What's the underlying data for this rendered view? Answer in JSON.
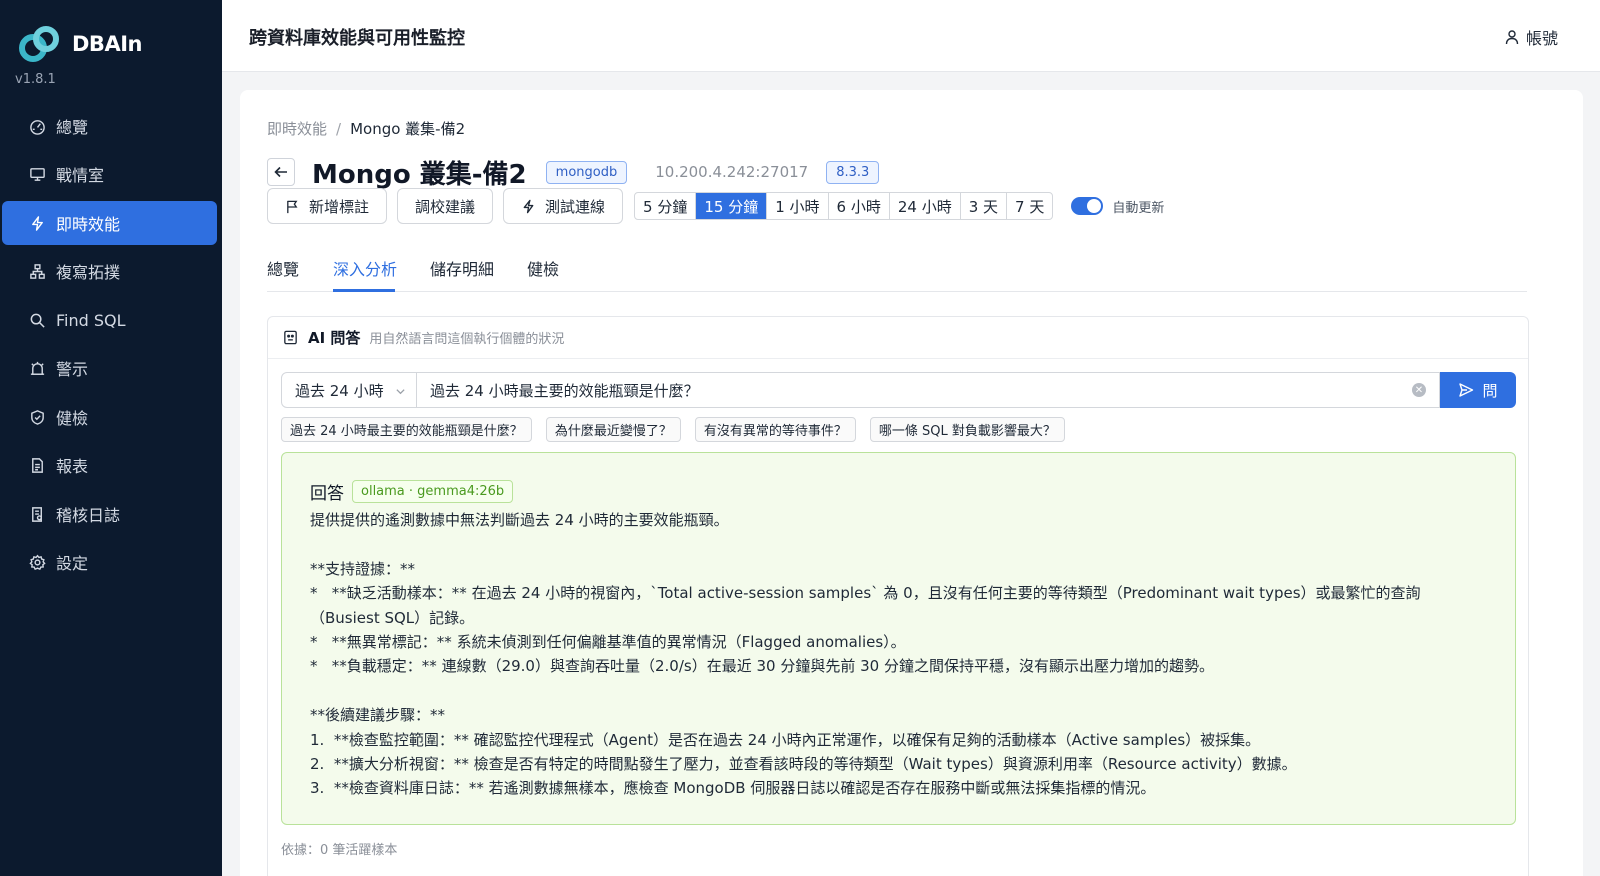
{
  "app": {
    "name": "DBAIn",
    "version": "v1.8.1",
    "header_title": "跨資料庫效能與可用性監控",
    "account_label": "帳號"
  },
  "sidebar": {
    "items": [
      {
        "label": "總覽",
        "icon": "dashboard-icon"
      },
      {
        "label": "戰情室",
        "icon": "monitor-icon"
      },
      {
        "label": "即時效能",
        "icon": "lightning-icon",
        "active": true
      },
      {
        "label": "複寫拓撲",
        "icon": "topology-icon"
      },
      {
        "label": "Find SQL",
        "icon": "search-icon"
      },
      {
        "label": "警示",
        "icon": "alarm-icon"
      },
      {
        "label": "健檢",
        "icon": "shield-icon"
      },
      {
        "label": "報表",
        "icon": "document-icon"
      },
      {
        "label": "稽核日誌",
        "icon": "audit-icon"
      },
      {
        "label": "設定",
        "icon": "gear-icon"
      }
    ]
  },
  "breadcrumb": {
    "parent": "即時效能",
    "separator": "/",
    "current": "Mongo 叢集-備2"
  },
  "instance": {
    "title": "Mongo 叢集-備2",
    "engine_tag": "mongodb",
    "host": "10.200.4.242:27017",
    "version_tag": "8.3.3"
  },
  "actions": {
    "add_annotation": "新增標註",
    "tuning_advice": "調校建議",
    "test_connection": "測試連線"
  },
  "time_ranges": {
    "options": [
      "5 分鐘",
      "15 分鐘",
      "1 小時",
      "6 小時",
      "24 小時",
      "3 天",
      "7 天"
    ],
    "selected": "15 分鐘"
  },
  "auto_refresh": {
    "label": "自動更新",
    "enabled": true
  },
  "tabs": {
    "items": [
      "總覽",
      "深入分析",
      "儲存明細",
      "健檢"
    ],
    "active": "深入分析"
  },
  "ai": {
    "title": "AI 問答",
    "subtitle": "用自然語言問這個執行個體的狀況",
    "period": "過去 24 小時",
    "question": "過去 24 小時最主要的效能瓶頸是什麼？",
    "ask_label": "問",
    "suggestions": [
      "過去 24 小時最主要的效能瓶頸是什麼？",
      "為什麼最近變慢了？",
      "有沒有異常的等待事件？",
      "哪一條 SQL 對負載影響最大？"
    ],
    "answer_label": "回答",
    "model_tag": "ollama · gemma4:26b",
    "answer": {
      "intro": "提供提供的遙測數據中無法判斷過去 24 小時的主要效能瓶頸。",
      "support_heading": "**支持證據：**",
      "support_lines": [
        "*   **缺乏活動樣本：** 在過去 24 小時的視窗內，`Total active-session samples` 為 0，且沒有任何主要的等待類型（Predominant wait types）或最繁忙的查詢（Busiest SQL）記錄。",
        "*   **無異常標記：** 系統未偵測到任何偏離基準值的異常情況（Flagged anomalies）。",
        "*   **負載穩定：** 連線數（29.0）與查詢吞吐量（2.0/s）在最近 30 分鐘與先前 30 分鐘之間保持平穩，沒有顯示出壓力增加的趨勢。"
      ],
      "next_heading": "**後續建議步驟：**",
      "next_lines": [
        "1.  **檢查監控範圍：** 確認監控代理程式（Agent）是否在過去 24 小時內正常運作，以確保有足夠的活動樣本（Active samples）被採集。",
        "2.  **擴大分析視窗：** 檢查是否有特定的時間點發生了壓力，並查看該時段的等待類型（Wait types）與資源利用率（Resource activity）數據。",
        "3.  **檢查資料庫日誌：** 若遙測數據無樣本，應檢查 MongoDB 伺服器日誌以確認是否存在服務中斷或無法採集指標的情況。"
      ]
    },
    "footnote": "依據：0 筆活躍樣本"
  },
  "colors": {
    "sidebar_bg": "#0c1a2e",
    "accent": "#2f6fe0",
    "answer_bg": "#f4fbec",
    "answer_border": "#b9e29a"
  }
}
